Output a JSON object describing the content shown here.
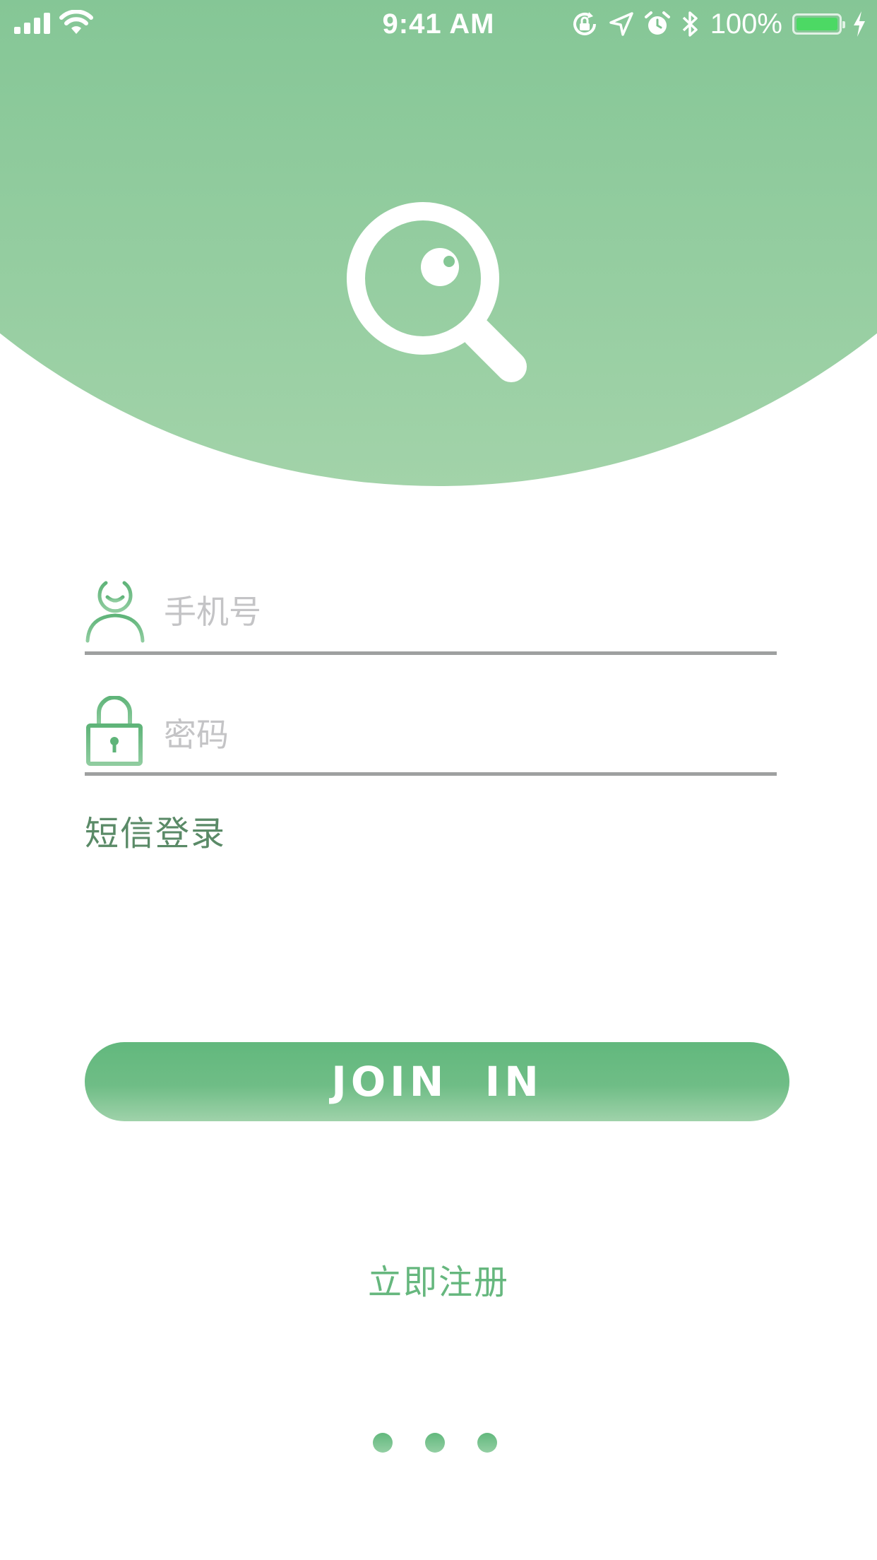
{
  "status_bar": {
    "time": "9:41 AM",
    "battery_percent": "100%",
    "icons": [
      "signal-icon",
      "wifi-icon",
      "orientation-lock-icon",
      "location-icon",
      "alarm-icon",
      "bluetooth-icon",
      "battery-icon",
      "charging-icon"
    ]
  },
  "logo": {
    "icon": "magnifier-eye-icon"
  },
  "form": {
    "phone": {
      "placeholder": "手机号",
      "value": "",
      "icon": "user-icon"
    },
    "password": {
      "placeholder": "密码",
      "value": "",
      "icon": "lock-icon"
    },
    "sms_login_label": "短信登录"
  },
  "join_button": {
    "label": "JOIN  IN"
  },
  "register_label": "立即注册",
  "page_indicator": {
    "count": 3
  },
  "colors": {
    "brand_green": "#77bf88",
    "button_green": "#62b87d",
    "link_green": "#66b77e",
    "sms_green": "#5a8a67",
    "placeholder_gray": "#c4c4c6",
    "underline_gray": "#9ea0a0"
  }
}
